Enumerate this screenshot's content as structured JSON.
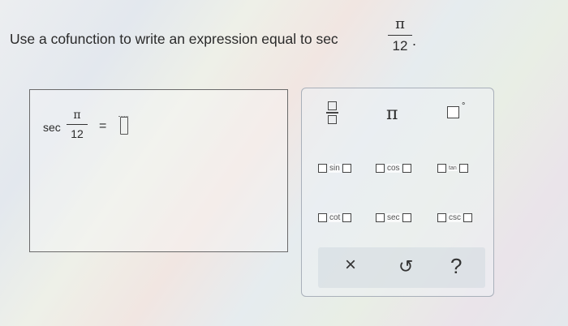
{
  "question": {
    "text": "Use a cofunction to write an expression equal to sec",
    "numerator": "π",
    "denominator": "12",
    "punct": "."
  },
  "answer": {
    "func": "sec",
    "numerator": "π",
    "denominator": "12",
    "equals": "="
  },
  "palette": {
    "pi": "π",
    "degree": "°",
    "trig_row1": [
      "sin",
      "cos",
      "tan"
    ],
    "trig_row2": [
      "cot",
      "sec",
      "csc"
    ],
    "actions": {
      "clear": "×",
      "undo": "↺",
      "help": "?"
    }
  }
}
